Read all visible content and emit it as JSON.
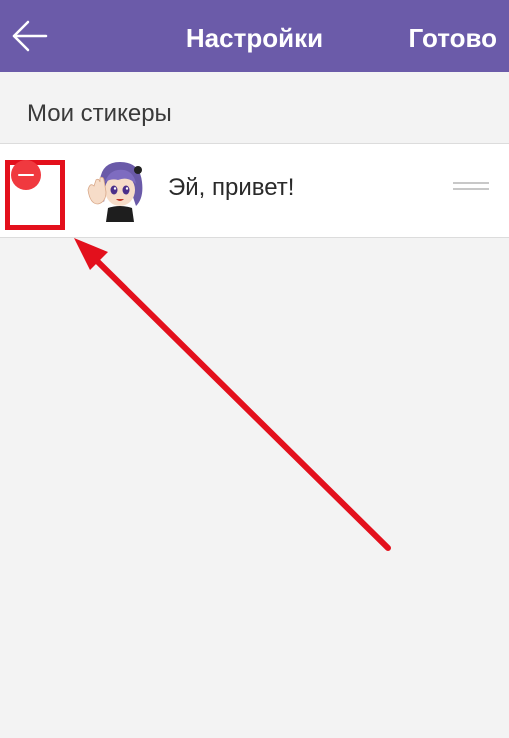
{
  "navbar": {
    "title": "Настройки",
    "done_label": "Готово",
    "background": "#6b5ba9"
  },
  "section": {
    "title": "Мои стикеры"
  },
  "stickers": [
    {
      "name": "Эй, привет!",
      "icon": "waving-girl-sticker-icon"
    }
  ],
  "colors": {
    "delete": "#f0393f",
    "annotation": "#e3101c"
  }
}
